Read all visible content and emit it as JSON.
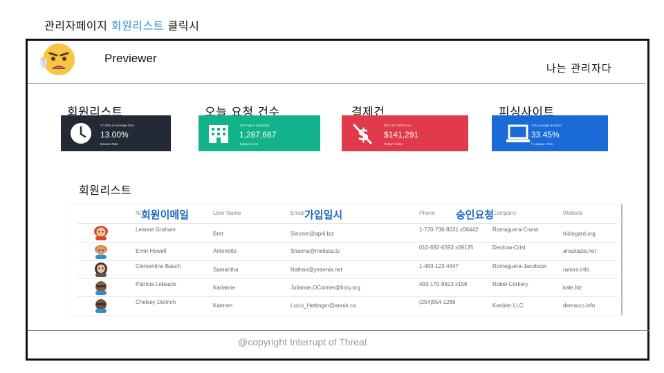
{
  "caption": {
    "prefix": "관리자페이지",
    "highlight": "회원리스트",
    "suffix": "클릭시"
  },
  "header": {
    "app_title": "Previewer",
    "admin_label": "나는 관리자다"
  },
  "stat_cards": [
    {
      "label": "회원리스트",
      "small": "17.25% on average time",
      "value": "13.00%",
      "sub": "Bounce Rate",
      "icon": "clock-icon",
      "color": "#232a36"
    },
    {
      "label": "오늘 요청 건수",
      "small": "13% higher yesterday",
      "value": "1,287,687",
      "sub": "Today's Visits",
      "icon": "building-icon",
      "color": "#12b28b"
    },
    {
      "label": "결제건",
      "small": "$117,212 before tax",
      "value": "$141,291",
      "sub": "Today's Sales",
      "icon": "dollar-icon",
      "color": "#e03a4b"
    },
    {
      "label": "피싱사이트",
      "small": "13% average duration",
      "value": "33.45%",
      "sub": "% Unique Visits",
      "icon": "laptop-icon",
      "color": "#1a6ad8"
    }
  ],
  "members": {
    "title": "회원리스트",
    "columns": [
      "Name",
      "User Name",
      "Email",
      "Phone",
      "Company",
      "Website"
    ],
    "overlays": [
      "회원이메일",
      "가입일시",
      "승인요청"
    ],
    "rows": [
      {
        "name": "Leanne Graham",
        "username": "Bret",
        "email": "Sincere@april.biz",
        "phone": "1-770-736-8031 x56442",
        "company": "Romaguera-Crona",
        "website": "hildegard.org"
      },
      {
        "name": "Ervin Howell",
        "username": "Antonette",
        "email": "Shanna@melissa.tv",
        "phone": "010-692-6593 x09125",
        "company": "Deckow-Crist",
        "website": "anastasia.net"
      },
      {
        "name": "Clementine Bauch",
        "username": "Samantha",
        "email": "Nathan@yesenia.net",
        "phone": "1-463-123-4447",
        "company": "Romaguera-Jacobson",
        "website": "ramiro.info"
      },
      {
        "name": "Patricia Lebsack",
        "username": "Karianne",
        "email": "Julianne.OConner@kory.org",
        "phone": "493-170-9623 x156",
        "company": "Robel-Corkery",
        "website": "kale.biz"
      },
      {
        "name": "Chelsey Dietrich",
        "username": "Kamren",
        "email": "Lucio_Hettinger@annie.ca",
        "phone": "(254)954-1289",
        "company": "Keebler LLC",
        "website": "demarco.info"
      }
    ]
  },
  "footer": {
    "copyright": "@copyright Interrupt of Threat"
  }
}
